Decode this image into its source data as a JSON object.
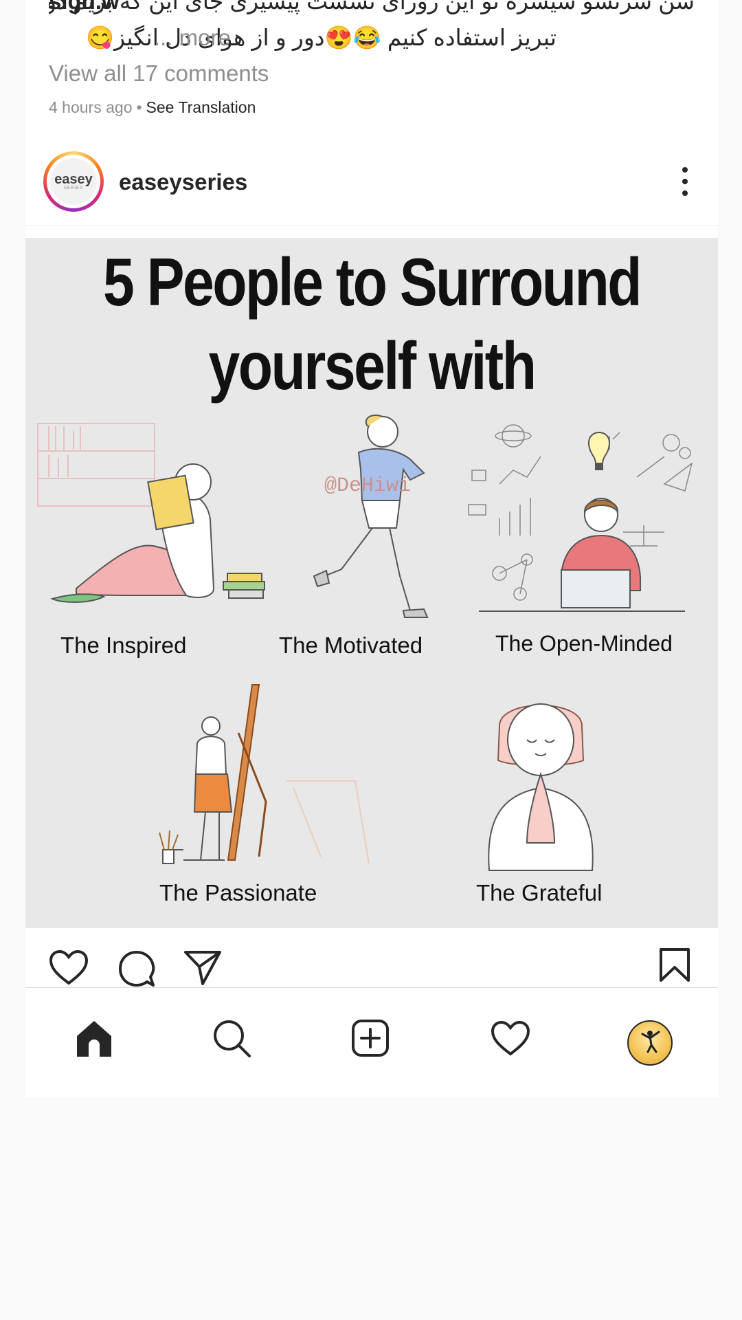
{
  "caption": {
    "cut_line": "شن سرنسو سیسره تو این زورای نسست پیشیری جای این که بریم دور",
    "cut_line_left": "sign.w",
    "line": "تبریز استفاده کنیم 😂😍دور و از هوای دل انگیز😋",
    "more_label": "... more",
    "view_comments": "View all 17 comments",
    "time_ago": "4 hours ago",
    "separator": "•",
    "see_translation": "See Translation"
  },
  "post": {
    "username": "easeyseries",
    "avatar_text": "easey",
    "avatar_sub": "SERIES",
    "image": {
      "headline_line1": "5 People to Surround",
      "headline_line2": "yourself with",
      "watermark": "@DeHiwi",
      "labels": [
        "The Inspired",
        "The Motivated",
        "The Open-Minded",
        "The Passionate",
        "The Grateful"
      ]
    }
  },
  "actions": {
    "icons": [
      "heart-icon",
      "comment-icon",
      "share-icon",
      "bookmark-icon"
    ]
  },
  "tabbar": {
    "tabs": [
      "home-icon",
      "search-icon",
      "create-icon",
      "activity-heart-icon",
      "profile-avatar"
    ]
  }
}
